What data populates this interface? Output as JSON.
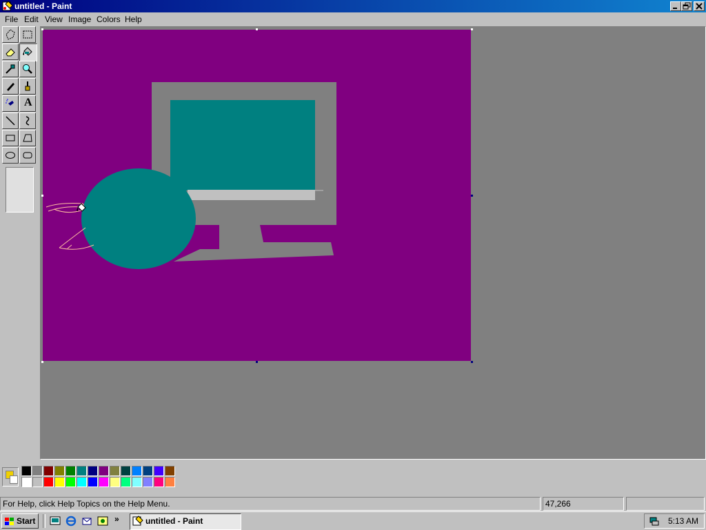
{
  "window": {
    "title": "untitled - Paint"
  },
  "menu": {
    "items": [
      "File",
      "Edit",
      "View",
      "Image",
      "Colors",
      "Help"
    ]
  },
  "tools": [
    {
      "name": "free-form-select",
      "active": false
    },
    {
      "name": "select",
      "active": false
    },
    {
      "name": "eraser",
      "active": false
    },
    {
      "name": "fill-with-color",
      "active": true
    },
    {
      "name": "pick-color",
      "active": false
    },
    {
      "name": "magnifier",
      "active": false
    },
    {
      "name": "pencil",
      "active": false
    },
    {
      "name": "brush",
      "active": false
    },
    {
      "name": "airbrush",
      "active": false
    },
    {
      "name": "text",
      "active": false
    },
    {
      "name": "line",
      "active": false
    },
    {
      "name": "curve",
      "active": false
    },
    {
      "name": "rectangle",
      "active": false
    },
    {
      "name": "polygon",
      "active": false
    },
    {
      "name": "ellipse",
      "active": false
    },
    {
      "name": "rounded-rectangle",
      "active": false
    }
  ],
  "text_tool_glyph": "A",
  "palette": {
    "foreground": "#f0d000",
    "background": "#ffffff",
    "row1": [
      "#000000",
      "#808080",
      "#800000",
      "#808000",
      "#008000",
      "#008080",
      "#000080",
      "#800080",
      "#808040",
      "#004040",
      "#0080ff",
      "#004080",
      "#4000ff",
      "#804000"
    ],
    "row2": [
      "#ffffff",
      "#c0c0c0",
      "#ff0000",
      "#ffff00",
      "#00ff00",
      "#00ffff",
      "#0000ff",
      "#ff00ff",
      "#ffff80",
      "#00ff80",
      "#80ffff",
      "#8080ff",
      "#ff0080",
      "#ff8040"
    ]
  },
  "canvas": {
    "background": "#800080",
    "monitor_frame": "#808080",
    "monitor_screen": "#008080",
    "monitor_bezel_light": "#c0c0c0",
    "ellipse_color": "#008080",
    "scribble_color": "#ffc0a0"
  },
  "status": {
    "help": "For Help, click Help Topics on the Help Menu.",
    "coords": "47,266",
    "size": ""
  },
  "taskbar": {
    "start": "Start",
    "app": "untitled - Paint",
    "clock": "5:13 AM",
    "chevron": "»"
  }
}
